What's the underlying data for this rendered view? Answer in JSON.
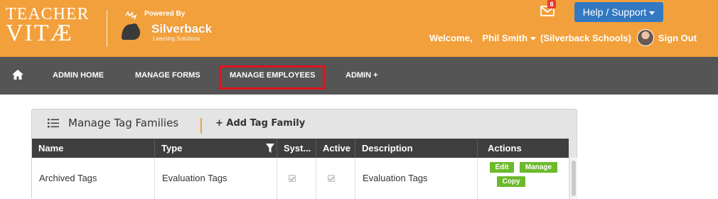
{
  "header": {
    "logo_line1": "TEACHER",
    "logo_line2": "VITÆ",
    "powered_by": "Powered By",
    "brand": "Silverback",
    "brand_tagline": "Learning Solutions",
    "mail_count": "8",
    "help_label": "Help / Support",
    "welcome": "Welcome,",
    "user_name": "Phil Smith",
    "school": "(Silverback Schools)",
    "sign_out": "Sign Out"
  },
  "nav": {
    "items": [
      {
        "label": "ADMIN HOME"
      },
      {
        "label": "MANAGE FORMS"
      },
      {
        "label": "MANAGE EMPLOYEES"
      },
      {
        "label": "ADMIN +"
      }
    ]
  },
  "panel": {
    "title": "Manage Tag Families",
    "add_label": "+ Add Tag Family"
  },
  "table": {
    "columns": [
      "Name",
      "Type",
      "Syst...",
      "Active",
      "Description",
      "Actions"
    ],
    "rows": [
      {
        "name": "Archived Tags",
        "type": "Evaluation Tags",
        "system": true,
        "active": true,
        "description": "Evaluation Tags",
        "actions": [
          "Edit",
          "Manage",
          "Copy"
        ]
      }
    ]
  },
  "colors": {
    "header_bg": "#f2a03b",
    "nav_bg": "#555555",
    "help_button": "#3279c2",
    "action_button": "#6cba2c",
    "highlight_box": "#e0141c"
  },
  "icons": [
    "home-icon",
    "mail-icon",
    "list-icon",
    "filter-icon",
    "caret-down-icon"
  ]
}
